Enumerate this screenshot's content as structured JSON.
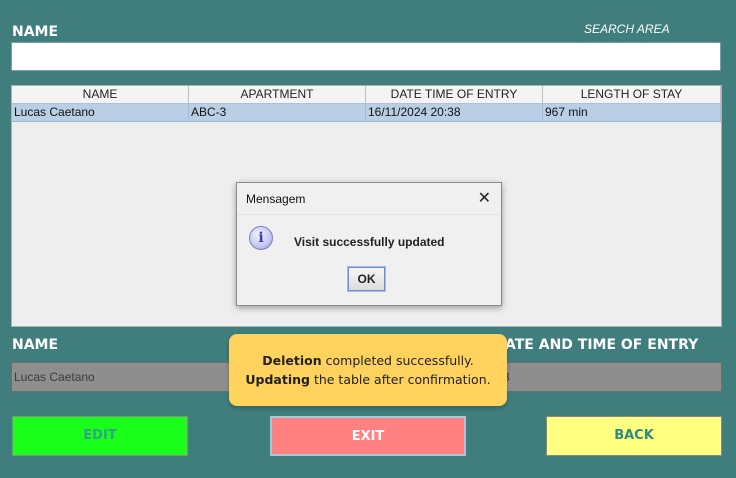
{
  "header": {
    "name_label": "NAME",
    "search_area": "SEARCH AREA"
  },
  "search": {
    "value": "",
    "placeholder": ""
  },
  "table": {
    "columns": [
      "NAME",
      "APARTMENT",
      "DATE TIME OF ENTRY",
      "LENGTH OF STAY"
    ],
    "rows": [
      [
        "Lucas Caetano",
        "ABC-3",
        "16/11/2024 20:38",
        "967 min"
      ]
    ]
  },
  "details": {
    "name_label": "NAME",
    "entry_label": "ATE AND TIME OF ENTRY",
    "name_value": "Lucas Caetano",
    "entry_value": "8"
  },
  "buttons": {
    "edit": "EDIT",
    "exit": "EXIT",
    "back": "BACK"
  },
  "dialog": {
    "title": "Mensagem",
    "close": "✕",
    "icon": "info-icon",
    "icon_glyph": "i",
    "message": "Visit successfully updated",
    "ok": "OK"
  },
  "toast": {
    "line1_bold": "Deletion",
    "line1_rest": " completed successfully.",
    "line2_bold": "Updating",
    "line2_rest": " the table after confirmation."
  },
  "colors": {
    "background": "#3f7e7c",
    "edit_button": "#1aff1a",
    "exit_button": "#ff8080",
    "back_button": "#ffff80",
    "toast": "#ffd25e",
    "selected_row": "#b8cfe5"
  }
}
